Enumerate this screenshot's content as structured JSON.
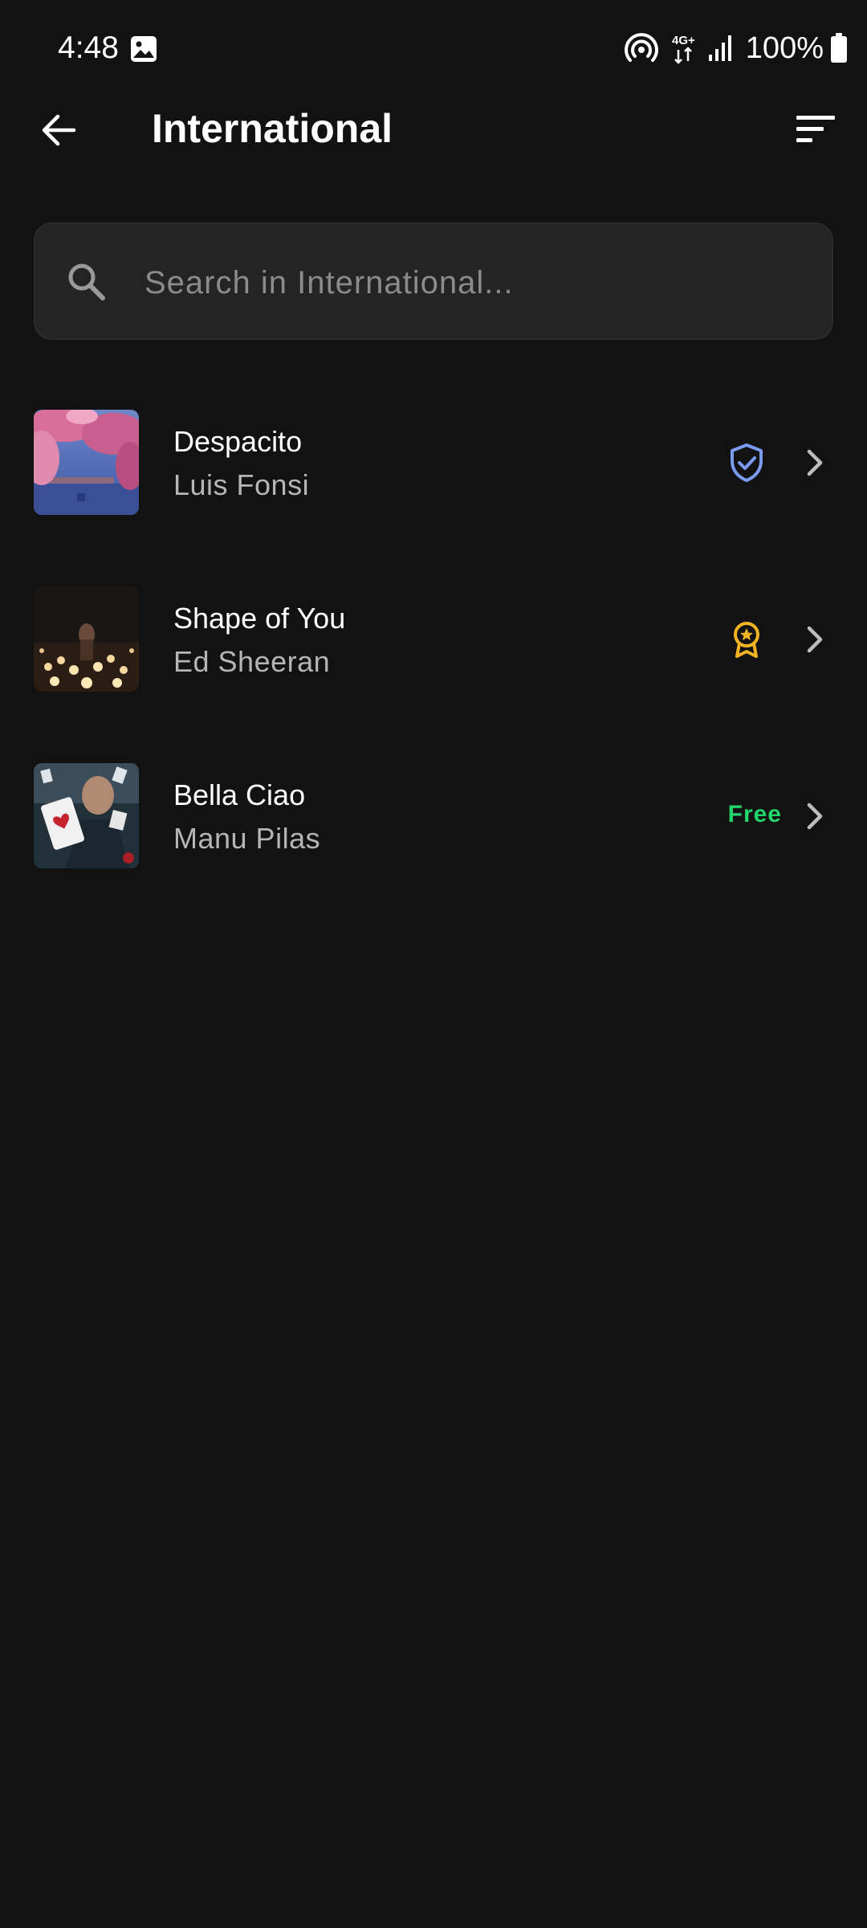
{
  "status_bar": {
    "time": "4:48",
    "battery_percent": "100%",
    "network_label": "4G+",
    "icons": [
      "gallery-icon",
      "hotspot-icon",
      "network-4g-icon",
      "signal-icon",
      "battery-icon"
    ]
  },
  "header": {
    "title": "International",
    "back_icon": "arrow-left-icon",
    "sort_icon": "sort-icon"
  },
  "search": {
    "placeholder": "Search in International...",
    "value": ""
  },
  "songs": [
    {
      "title": "Despacito",
      "artist": "Luis Fonsi",
      "badge": "verified-shield-icon",
      "badge_color": "#7a9bf0"
    },
    {
      "title": "Shape of You",
      "artist": "Ed Sheeran",
      "badge": "award-medal-icon",
      "badge_color": "#f0b323"
    },
    {
      "title": "Bella Ciao",
      "artist": "Manu Pilas",
      "badge_text": "Free",
      "badge_color": "#1fd56c"
    }
  ],
  "colors": {
    "background": "#121212",
    "search_background": "#242424",
    "secondary_text": "#b5b5b5",
    "accent_blue": "#7a9bf0",
    "accent_gold": "#f0b323",
    "accent_green": "#1fd56c"
  }
}
